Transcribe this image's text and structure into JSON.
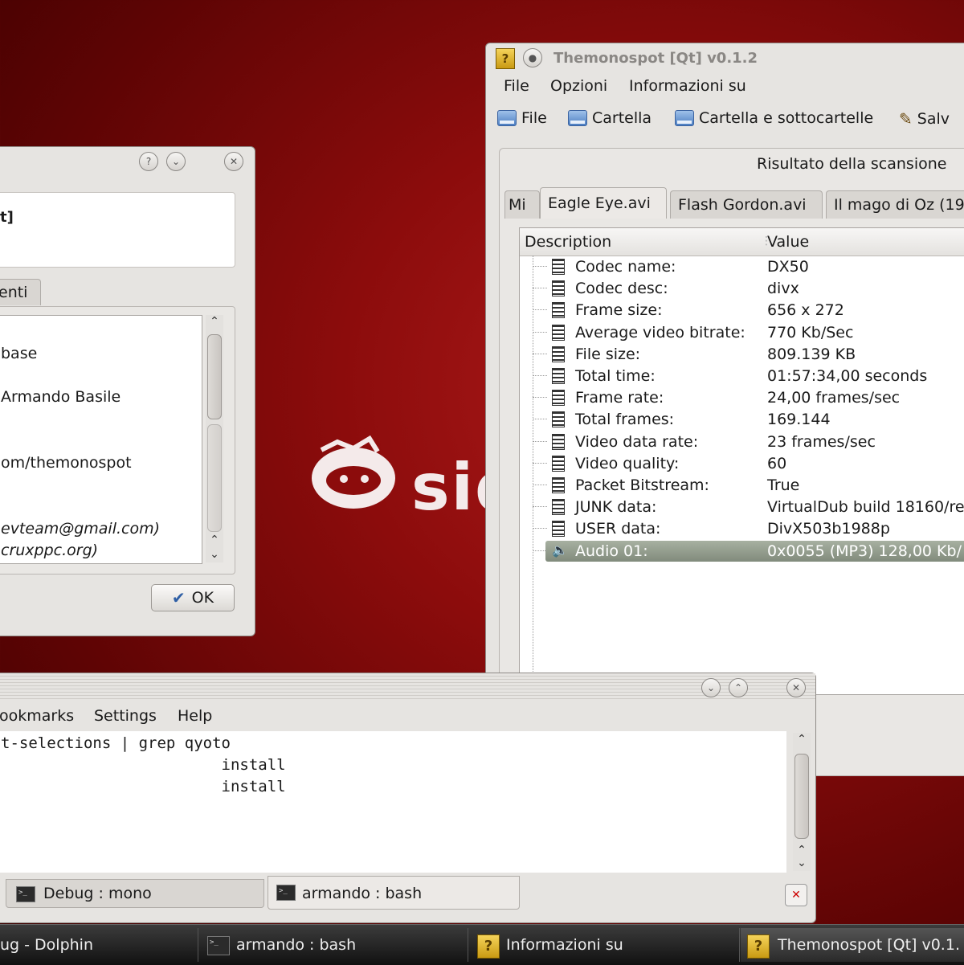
{
  "desktop": {
    "logo_text": "sid"
  },
  "about_dialog": {
    "header_text": "t]",
    "tab_label": "enti",
    "lines": [
      "base",
      "Armando Basile",
      "om/themonospot",
      "evteam@gmail.com)",
      "cruxppc.org)"
    ],
    "ok_label": "OK"
  },
  "themonospot": {
    "title": "Themonospot [Qt] v0.1.2",
    "menu": [
      "File",
      "Opzioni",
      "Informazioni su"
    ],
    "toolbar": {
      "file": "File",
      "folder": "Cartella",
      "folder_sub": "Cartella e sottocartelle",
      "save": "Salv"
    },
    "group_title": "Risultato della scansione",
    "tabs": [
      "Mi",
      "Eagle Eye.avi",
      "Flash Gordon.avi",
      "Il mago di Oz (19"
    ],
    "active_tab_index": 1,
    "columns": {
      "description": "Description",
      "value": "Value"
    },
    "rows": [
      {
        "d": "Codec name:",
        "v": "DX50"
      },
      {
        "d": "Codec desc:",
        "v": "divx"
      },
      {
        "d": "Frame size:",
        "v": "656 x 272"
      },
      {
        "d": "Average video bitrate:",
        "v": "770 Kb/Sec"
      },
      {
        "d": "File size:",
        "v": "809.139 KB"
      },
      {
        "d": "Total time:",
        "v": "01:57:34,00 seconds"
      },
      {
        "d": "Frame rate:",
        "v": "24,00 frames/sec"
      },
      {
        "d": "Total frames:",
        "v": "169.144"
      },
      {
        "d": "Video data rate:",
        "v": "23 frames/sec"
      },
      {
        "d": "Video quality:",
        "v": "60"
      },
      {
        "d": "Packet Bitstream:",
        "v": "True"
      },
      {
        "d": "JUNK data:",
        "v": "VirtualDub build 18160/re"
      },
      {
        "d": "USER data:",
        "v": "DivX503b1988p"
      },
      {
        "d": "Audio 01:",
        "v": "0x0055 (MP3) 128,00 Kb/"
      }
    ],
    "selected_row_index": 13
  },
  "konsole": {
    "menu": [
      "ookmarks",
      "Settings",
      "Help"
    ],
    "lines": [
      "t-selections | grep qyoto",
      "                        install",
      "                        install"
    ],
    "tabs": [
      "Debug : mono",
      "armando : bash"
    ]
  },
  "taskbar": {
    "items": [
      "ug - Dolphin",
      "armando : bash",
      "Informazioni su",
      "Themonospot [Qt] v0.1."
    ]
  }
}
